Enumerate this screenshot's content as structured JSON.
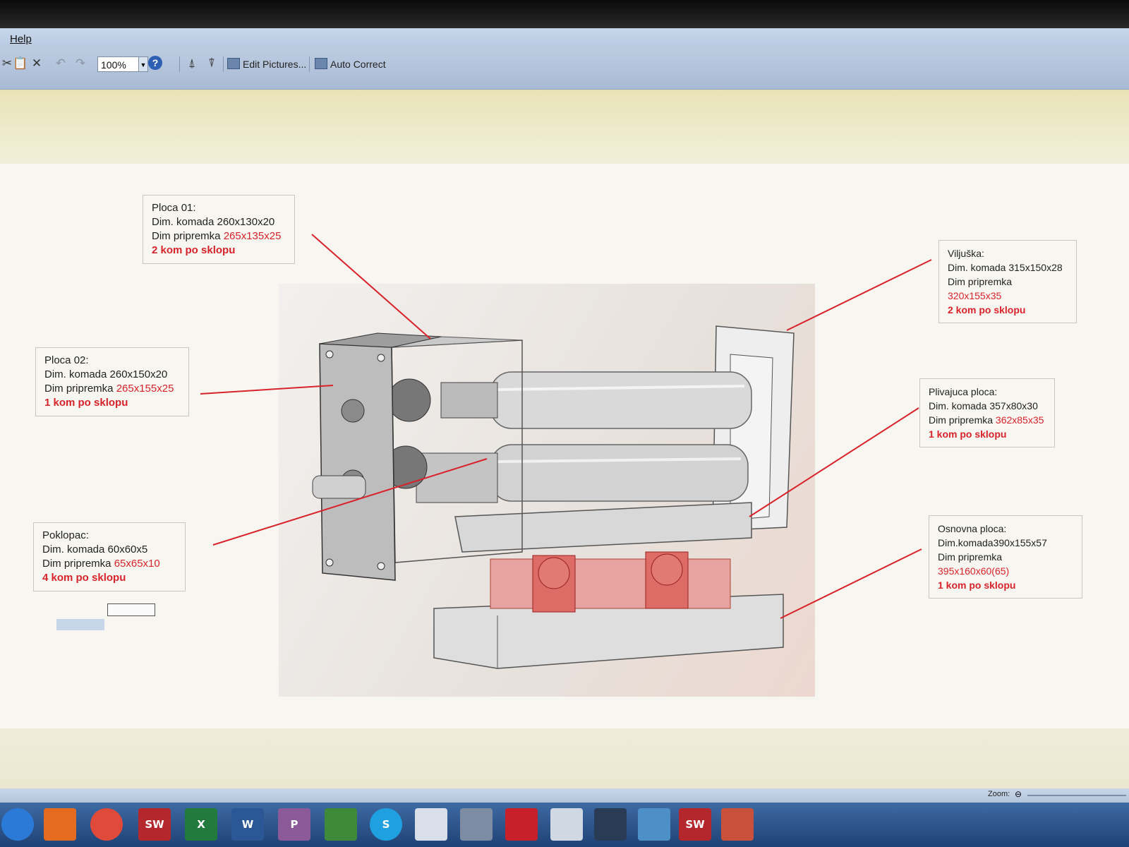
{
  "menu": {
    "help": "Help"
  },
  "toolbar": {
    "zoom_value": "100%",
    "edit_pictures": "Edit Pictures...",
    "auto_correct": "Auto Correct"
  },
  "callouts": [
    {
      "id": "ploca-01",
      "title": "Ploca 01:",
      "dim_komada": "Dim. komada 260x130x20",
      "dim_pripremka_label": "Dim pripremka ",
      "dim_pripremka_value": "265x135x25",
      "qty": "2 kom po sklopu"
    },
    {
      "id": "ploca-02",
      "title": "Ploca 02:",
      "dim_komada": "Dim. komada 260x150x20",
      "dim_pripremka_label": "Dim pripremka ",
      "dim_pripremka_value": "265x155x25",
      "qty": "1 kom po sklopu"
    },
    {
      "id": "poklopac",
      "title": "Poklopac:",
      "dim_komada": "Dim. komada 60x60x5",
      "dim_pripremka_label": "Dim pripremka ",
      "dim_pripremka_value": "65x65x10",
      "qty": "4 kom po sklopu"
    },
    {
      "id": "viljuska",
      "title": "Viljuška:",
      "dim_komada": "Dim. komada 315x150x28",
      "dim_pripremka_label": "Dim pripremka ",
      "dim_pripremka_value": "320x155x35",
      "qty": "2 kom po sklopu"
    },
    {
      "id": "plivajuca-ploca",
      "title": "Plivajuca ploca:",
      "dim_komada": "Dim. komada 357x80x30",
      "dim_pripremka_label": "Dim pripremka ",
      "dim_pripremka_value": "362x85x35",
      "qty": "1 kom po sklopu"
    },
    {
      "id": "osnovna-ploca",
      "title": "Osnovna ploca:",
      "dim_komada": "Dim.komada390x155x57",
      "dim_pripremka_label": "Dim pripremka ",
      "dim_pripremka_value": "395x160x60(65)",
      "qty": "1 kom po sklopu"
    }
  ],
  "statusbar": {
    "zoom_label": "Zoom:"
  },
  "taskbar": {
    "icons": [
      "start-icon",
      "firefox-icon",
      "chrome-icon",
      "solidworks-icon",
      "excel-icon",
      "word-icon",
      "publisher-icon",
      "spreadsheet-icon",
      "skype-icon",
      "document-icon",
      "magnifier-icon",
      "acrobat-icon",
      "folder-icon",
      "inkscape-icon",
      "paint-icon",
      "solidworks-2018-icon",
      "viewer-icon"
    ],
    "labels": {
      "solidworks": "SW",
      "excel": "X",
      "word": "W",
      "publisher": "P",
      "skype": "S",
      "solidworks_2018": "SW"
    }
  }
}
